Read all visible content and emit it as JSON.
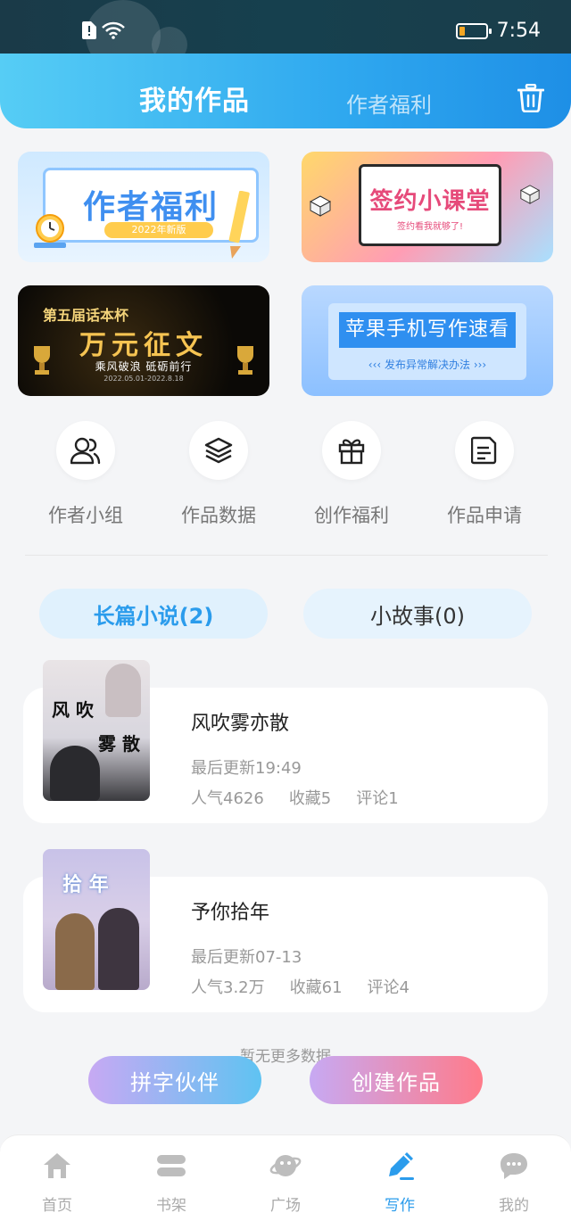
{
  "status_bar": {
    "time": "7:54"
  },
  "header": {
    "tab_active": "我的作品",
    "tab_other": "作者福利"
  },
  "banners": [
    {
      "title": "作者福利",
      "tag": "2022年新版"
    },
    {
      "title": "签约小课堂",
      "subtitle": "签约看我就够了!"
    },
    {
      "top": "第五届话本杯",
      "title": "万元征文",
      "subtitle": "乘风破浪 砥砺前行",
      "date": "2022.05.01-2022.8.18"
    },
    {
      "title": "苹果手机写作速看",
      "subtitle": "发布异常解决办法"
    }
  ],
  "quick": [
    {
      "label": "作者小组",
      "icon": "users-icon"
    },
    {
      "label": "作品数据",
      "icon": "layers-icon"
    },
    {
      "label": "创作福利",
      "icon": "gift-icon"
    },
    {
      "label": "作品申请",
      "icon": "document-icon"
    }
  ],
  "segments": {
    "novel": "长篇小说(2)",
    "story": "小故事(0)"
  },
  "works": [
    {
      "title": "风吹雾亦散",
      "updated": "最后更新19:49",
      "popularity": "人气4626",
      "favorites": "收藏5",
      "comments": "评论1",
      "cover_text_1": "风 吹",
      "cover_text_2": "雾 散"
    },
    {
      "title": "予你拾年",
      "updated": "最后更新07-13",
      "popularity": "人气3.2万",
      "favorites": "收藏61",
      "comments": "评论4",
      "cover_text": "拾 年"
    }
  ],
  "no_more": "暂无更多数据",
  "buttons": {
    "partner": "拼字伙伴",
    "create": "创建作品"
  },
  "nav": [
    {
      "label": "首页",
      "icon": "home-icon"
    },
    {
      "label": "书架",
      "icon": "bookshelf-icon"
    },
    {
      "label": "广场",
      "icon": "planet-icon"
    },
    {
      "label": "写作",
      "icon": "pen-icon",
      "active": true
    },
    {
      "label": "我的",
      "icon": "chat-icon"
    }
  ],
  "colors": {
    "accent": "#2b9cec",
    "header_start": "#56cdf5",
    "header_end": "#1e8fe6"
  }
}
